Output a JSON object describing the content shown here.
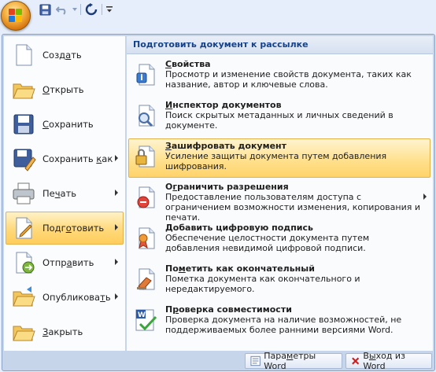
{
  "menu": {
    "items": [
      {
        "id": "create",
        "label_pre": "Созд",
        "label_ul": "а",
        "label_post": "ть",
        "icon": "new-document-icon",
        "has_arrow": false
      },
      {
        "id": "open",
        "label_pre": "",
        "label_ul": "О",
        "label_post": "ткрыть",
        "icon": "open-folder-icon",
        "has_arrow": false
      },
      {
        "id": "save",
        "label_pre": "",
        "label_ul": "С",
        "label_post": "охранить",
        "icon": "floppy-disk-icon",
        "has_arrow": false
      },
      {
        "id": "save-as",
        "label_pre": "Сохранить ",
        "label_ul": "к",
        "label_post": "ак",
        "icon": "save-as-icon",
        "has_arrow": true
      },
      {
        "id": "print",
        "label_pre": "Пе",
        "label_ul": "ч",
        "label_post": "ать",
        "icon": "printer-icon",
        "has_arrow": true
      },
      {
        "id": "prepare",
        "label_pre": "Подг",
        "label_ul": "о",
        "label_post": "товить",
        "icon": "prepare-document-icon",
        "has_arrow": true,
        "active": true
      },
      {
        "id": "send",
        "label_pre": "Отпр",
        "label_ul": "а",
        "label_post": "вить",
        "icon": "send-icon",
        "has_arrow": true
      },
      {
        "id": "publish",
        "label_pre": "Опубликова",
        "label_ul": "т",
        "label_post": "ь",
        "icon": "publish-folder-icon",
        "has_arrow": true
      },
      {
        "id": "close",
        "label_pre": "",
        "label_ul": "З",
        "label_post": "акрыть",
        "icon": "close-document-icon",
        "has_arrow": false
      }
    ]
  },
  "submenu": {
    "header": "Подготовить документ к рассылке",
    "items": [
      {
        "id": "properties",
        "title_pre": "",
        "title_ul": "С",
        "title_post": "войства",
        "desc": "Просмотр и изменение свойств документа, таких как название, автор и ключевые слова.",
        "icon": "properties-icon"
      },
      {
        "id": "inspector",
        "title_pre": "",
        "title_ul": "И",
        "title_post": "нспектор документов",
        "desc": "Поиск скрытых метаданных и личных сведений в документе.",
        "icon": "document-inspector-icon"
      },
      {
        "id": "encrypt",
        "title_pre": "",
        "title_ul": "З",
        "title_post": "ашифровать документ",
        "desc": "Усиление защиты документа путем добавления шифрования.",
        "icon": "encrypt-lock-icon",
        "active": true
      },
      {
        "id": "restrict",
        "title_pre": "О",
        "title_ul": "г",
        "title_post": "раничить разрешения",
        "desc": "Предоставление пользователям доступа с ограничением возможности изменения, копирования и печати.",
        "icon": "restrict-permission-icon",
        "has_arrow": true
      },
      {
        "id": "signature",
        "title_pre": "",
        "title_ul": "Д",
        "title_post": "обавить цифровую подпись",
        "desc": "Обеспечение целостности документа путем добавления невидимой цифровой подписи.",
        "icon": "digital-signature-icon"
      },
      {
        "id": "final",
        "title_pre": "По",
        "title_ul": "м",
        "title_post": "етить как окончательный",
        "desc": "Пометка документа как окончательного и нередактируемого.",
        "icon": "mark-final-icon"
      },
      {
        "id": "compat",
        "title_pre": "П",
        "title_ul": "р",
        "title_post": "оверка совместимости",
        "desc": "Проверка документа на наличие возможностей, не поддерживаемых более ранними версиями Word.",
        "icon": "compatibility-check-icon"
      }
    ]
  },
  "bottom": {
    "options_label_pre": "Пара",
    "options_label_ul": "м",
    "options_label_post": "етры Word",
    "exit_label_pre": "В",
    "exit_label_ul": "ы",
    "exit_label_post": "ход из Word"
  },
  "colors": {
    "accent_highlight": "#ffd97a",
    "header_text": "#15428b",
    "panel_border": "#8aa3c5"
  }
}
